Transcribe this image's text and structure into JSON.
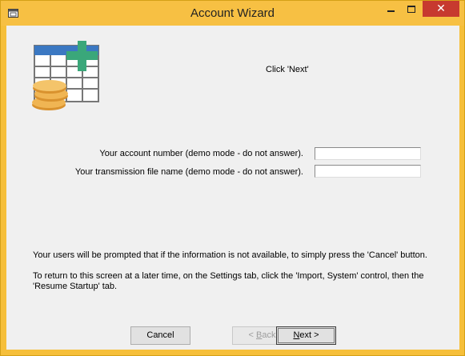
{
  "window": {
    "title": "Account Wizard",
    "close_glyph": "✕"
  },
  "instruction": "Click 'Next'",
  "fields": [
    {
      "label": "Your account number (demo mode - do not answer).",
      "value": ""
    },
    {
      "label": "Your transmission file name (demo mode - do not answer).",
      "value": ""
    }
  ],
  "notes": [
    "Your users will be prompted that if the information is not available, to simply press the 'Cancel' button.",
    "To return to this screen at a later time, on the Settings tab, click the 'Import, System'  control, then the 'Resume Startup' tab."
  ],
  "buttons": {
    "cancel": "Cancel",
    "back_prefix": "< ",
    "back_accel": "B",
    "back_rest": "ack",
    "next_accel": "N",
    "next_rest": "ext >"
  },
  "colors": {
    "titlebar": "#f7c043",
    "close": "#c7392f",
    "accent_plus": "#3aa77a",
    "table_header": "#3b78c2",
    "coins": "#e8a849"
  },
  "icons": {
    "app": "window-app-icon",
    "logo": "spreadsheet-add-coins-icon"
  }
}
